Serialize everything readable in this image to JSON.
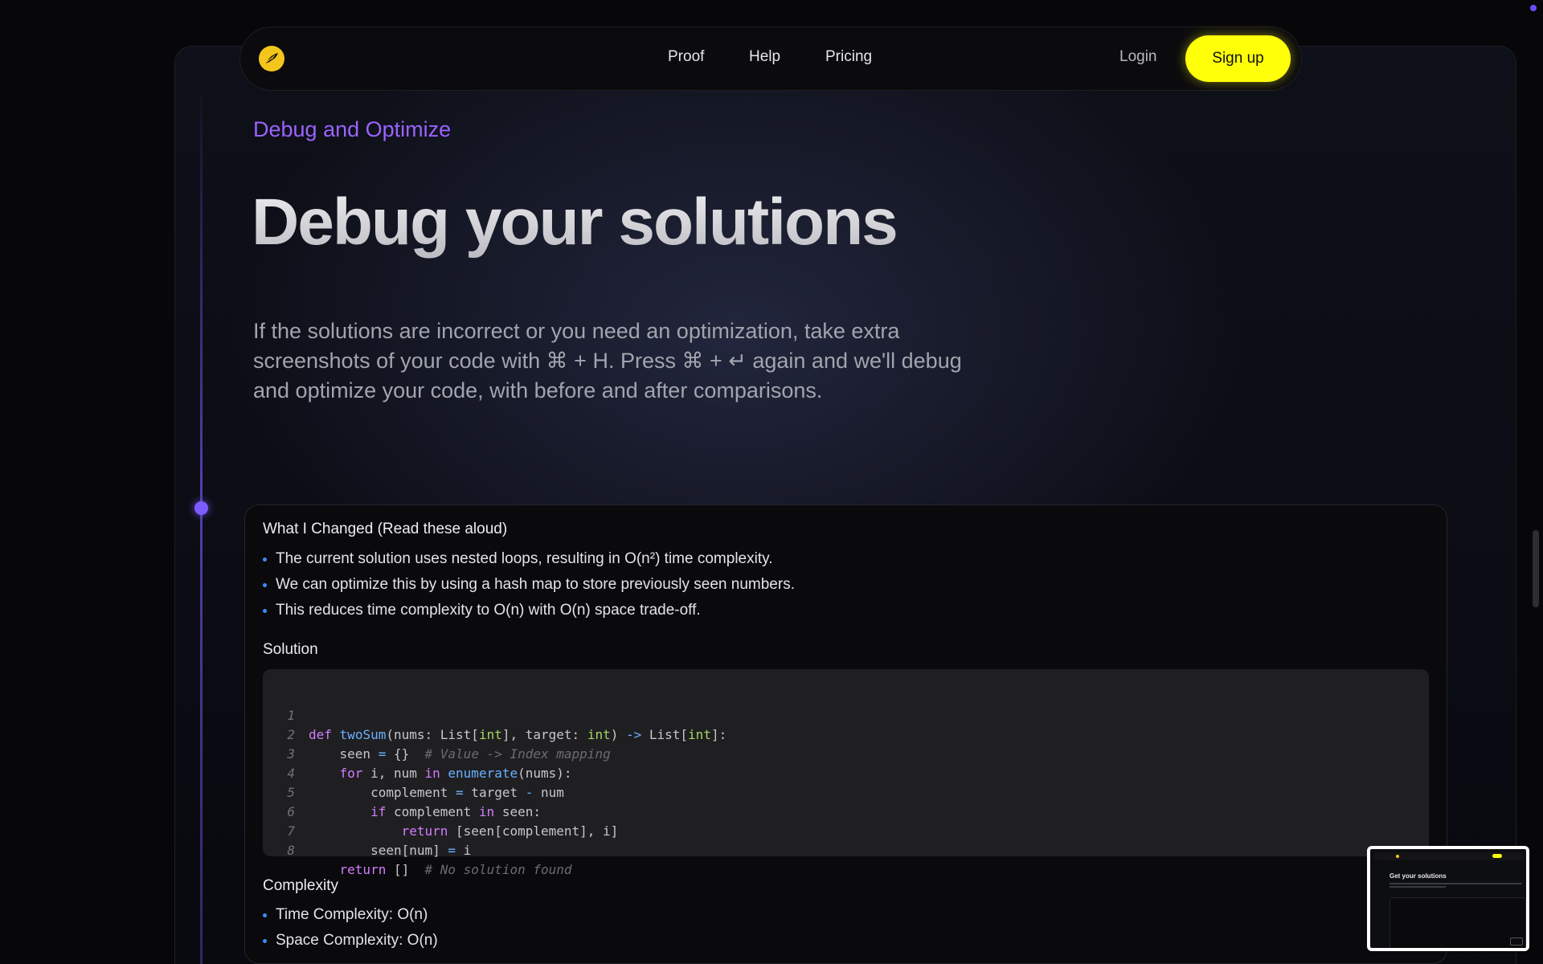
{
  "nav": {
    "links": [
      "Proof",
      "Help",
      "Pricing"
    ],
    "login": "Login",
    "signup": "Sign up"
  },
  "hero": {
    "eyebrow": "Debug and Optimize",
    "title": "Debug your solutions",
    "description": "If the solutions are incorrect or you need an optimization, take extra screenshots of your code with ⌘ + H. Press ⌘ + ↵ again and we'll debug and optimize your code, with before and after comparisons."
  },
  "card": {
    "changes_heading": "What I Changed (Read these aloud)",
    "changes": [
      "The current solution uses nested loops, resulting in O(n²) time complexity.",
      "We can optimize this by using a hash map to store previously seen numbers.",
      "This reduces time complexity to O(n) with O(n) space trade-off."
    ],
    "solution_heading": "Solution",
    "code_line_numbers": [
      "1",
      "2",
      "3",
      "4",
      "5",
      "6",
      "7",
      "8"
    ],
    "code_lines": [
      "def twoSum(nums: List[int], target: int) -> List[int]:",
      "    seen = {}  # Value -> Index mapping",
      "    for i, num in enumerate(nums):",
      "        complement = target - num",
      "        if complement in seen:",
      "            return [seen[complement], i]",
      "        seen[num] = i",
      "    return []  # No solution found"
    ],
    "complexity_heading": "Complexity",
    "complexity": [
      "Time Complexity: O(n)",
      "Space Complexity: O(n)"
    ]
  },
  "preview": {
    "title": "Get your solutions"
  },
  "colors": {
    "accent_purple": "#9a63ff",
    "signup_yellow": "#ffff0a",
    "logo_yellow": "#f4c61c",
    "bullet_blue": "#3a8dff"
  },
  "icons": {
    "logo": "feather-logo-icon",
    "timeline_marker": "timeline-dot-icon"
  }
}
